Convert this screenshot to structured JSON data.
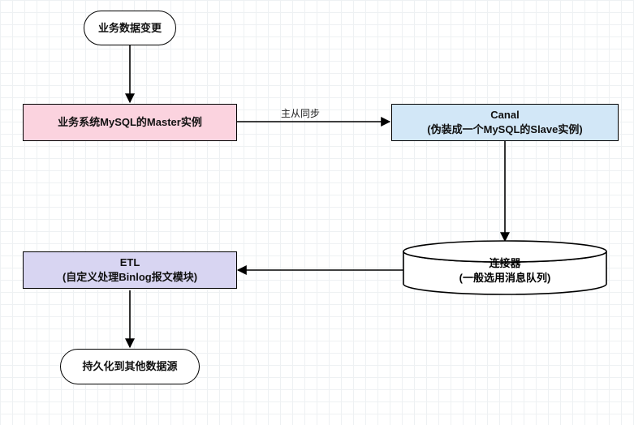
{
  "nodes": {
    "start": {
      "text": "业务数据变更"
    },
    "master": {
      "text": "业务系统MySQL的Master实例"
    },
    "canal": {
      "title": "Canal",
      "sub": "(伪装成一个MySQL的Slave实例)"
    },
    "connector": {
      "title": "连接器",
      "sub": "(一般选用消息队列)"
    },
    "etl": {
      "title": "ETL",
      "sub": "(自定义处理Binlog报文模块)"
    },
    "end": {
      "text": "持久化到其他数据源"
    }
  },
  "edges": {
    "sync_label": "主从同步"
  },
  "colors": {
    "pink": "#fbd3df",
    "blue": "#d2e7f7",
    "purple": "#d8d5f2"
  }
}
